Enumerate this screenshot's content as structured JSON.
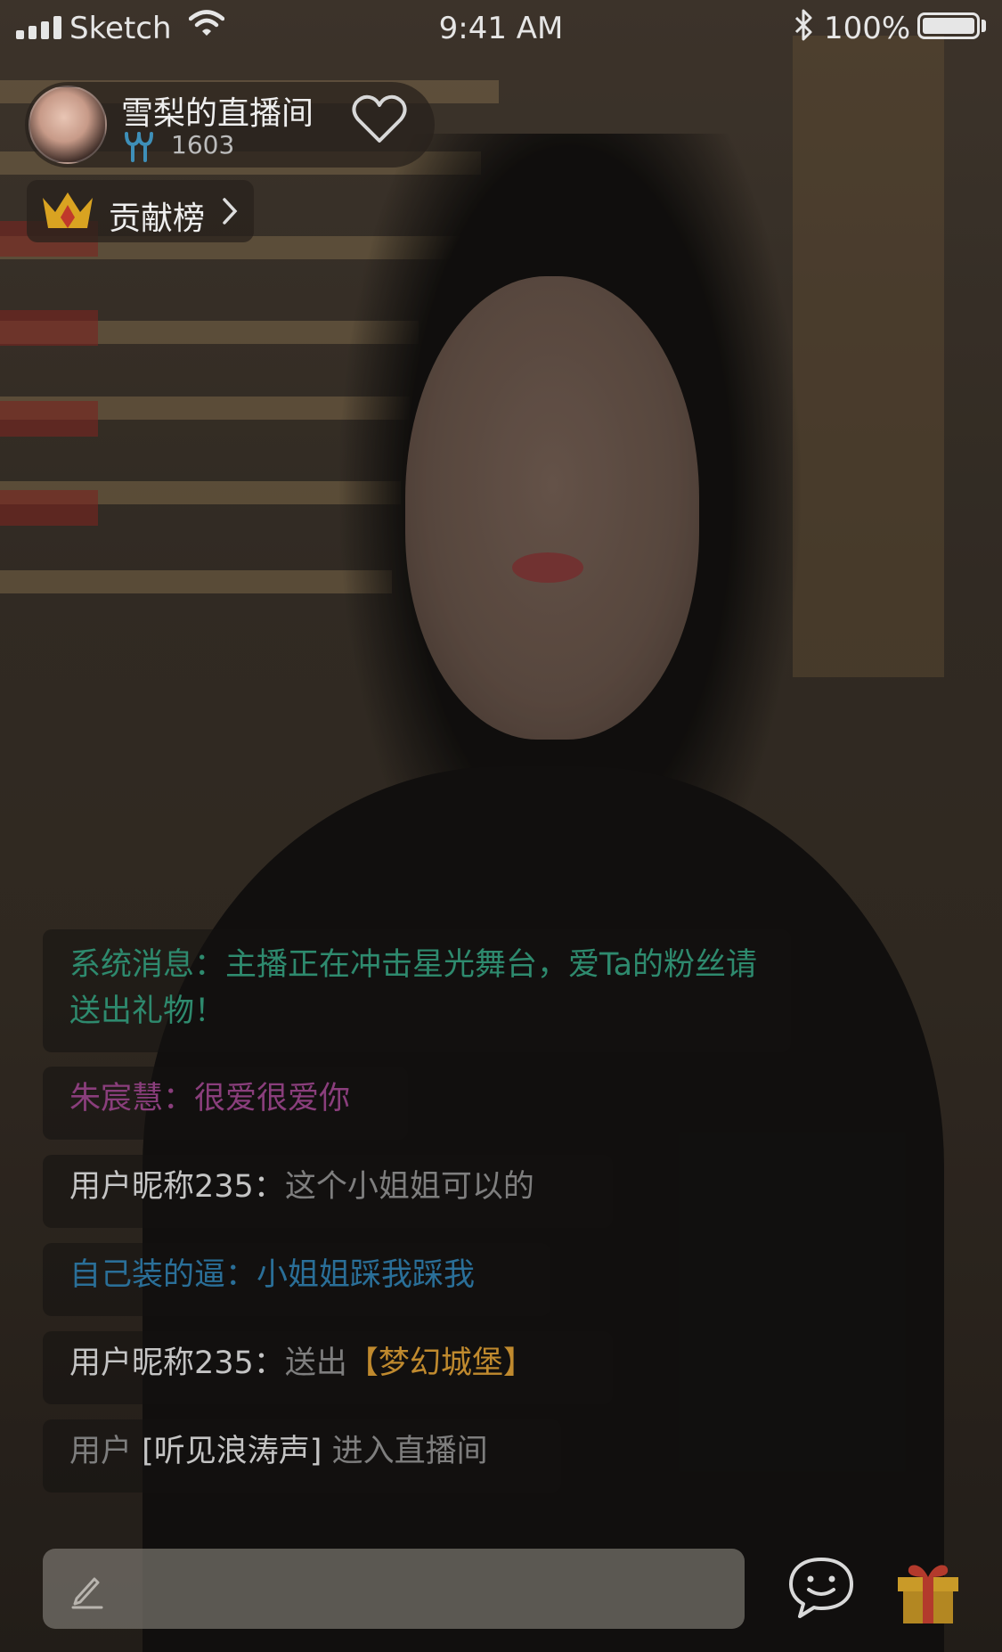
{
  "status_bar": {
    "carrier": "Sketch",
    "time": "9:41 AM",
    "battery": "100%"
  },
  "host": {
    "room_title": "雪梨的直播间",
    "viewer_count": "1603"
  },
  "rank": {
    "label": "贡献榜"
  },
  "chat": [
    {
      "name": "系统消息：",
      "text": "主播正在冲击星光舞台，爱Ta的粉丝请送出礼物！",
      "color": "#2e8a6e"
    },
    {
      "name": "朱宸慧：",
      "text": "很爱很爱你",
      "color": "#8a3e7c"
    },
    {
      "name": "用户昵称235：",
      "text": "这个小姐姐可以的",
      "color": "#c4c4c4"
    },
    {
      "name": "自己装的逼：",
      "text": "小姐姐踩我踩我",
      "color": "#2a6f98"
    },
    {
      "name": "用户昵称235：",
      "prefix": "送出",
      "gift": "【梦幻城堡】",
      "color": "#c08a2e"
    },
    {
      "prefix": "用户",
      "user": "[听见浪涛声]",
      "suffix": "进入直播间",
      "color": "#9a9a9a"
    }
  ],
  "icons": {
    "wifi": "wifi-icon",
    "bluetooth": "bluetooth-icon",
    "viewers": "viewers-icon",
    "follow": "heart-icon",
    "crown": "crown-icon",
    "chevron": "chevron-right-icon",
    "pencil": "pencil-icon",
    "chat": "chat-bubble-icon",
    "gift": "gift-icon"
  }
}
